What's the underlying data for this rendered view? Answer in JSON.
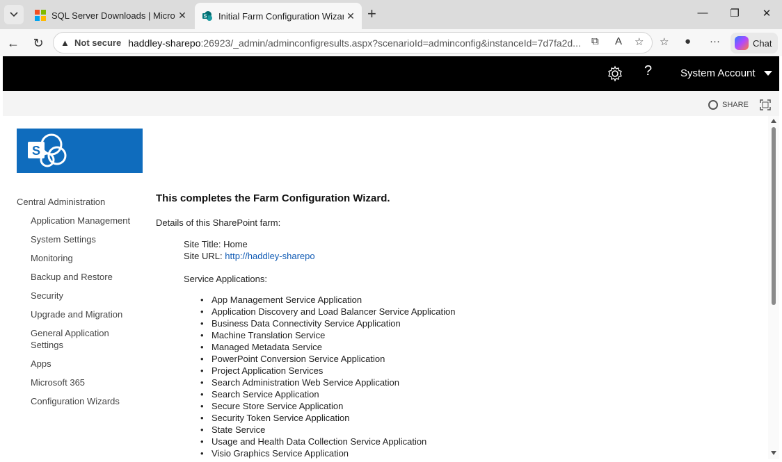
{
  "browser": {
    "tabs": [
      {
        "title": "SQL Server Downloads | Microsoft",
        "icon": "microsoft-logo-icon",
        "active": false
      },
      {
        "title": "Initial Farm Configuration Wizard",
        "icon": "sharepoint-icon",
        "active": true
      }
    ],
    "address": {
      "security_label": "Not secure",
      "host": "haddley-sharepo",
      "path": ":26923/_admin/adminconfigresults.aspx?scenarioId=adminconfig&instanceId=7d7fa2d..."
    },
    "chat_label": "Chat"
  },
  "suitebar": {
    "account_name": "System Account",
    "help_glyph": "?"
  },
  "ribbon": {
    "share_label": "SHARE"
  },
  "quicklaunch": {
    "root": "Central Administration",
    "items": [
      "Application Management",
      "System Settings",
      "Monitoring",
      "Backup and Restore",
      "Security",
      "Upgrade and Migration",
      "General Application Settings",
      "Apps",
      "Microsoft 365",
      "Configuration Wizards"
    ]
  },
  "main": {
    "heading": "This completes the Farm Configuration Wizard.",
    "details_label": "Details of this SharePoint farm:",
    "site_title_label": "Site Title: Home",
    "site_url_label": "Site URL: ",
    "site_url": "http://haddley-sharepo",
    "service_apps_label": "Service Applications:",
    "service_apps": [
      "App Management Service Application",
      "Application Discovery and Load Balancer Service Application",
      "Business Data Connectivity Service Application",
      "Machine Translation Service",
      "Managed Metadata Service",
      "PowerPoint Conversion Service Application",
      "Project Application Services",
      "Search Administration Web Service Application",
      "Search Service Application",
      "Secure Store Service Application",
      "Security Token Service Application",
      "State Service",
      "Usage and Health Data Collection Service Application",
      "Visio Graphics Service Application"
    ]
  },
  "colors": {
    "suitebar": "#000000",
    "logo_tile": "#0f6cbd",
    "link": "#0f5ab4"
  }
}
